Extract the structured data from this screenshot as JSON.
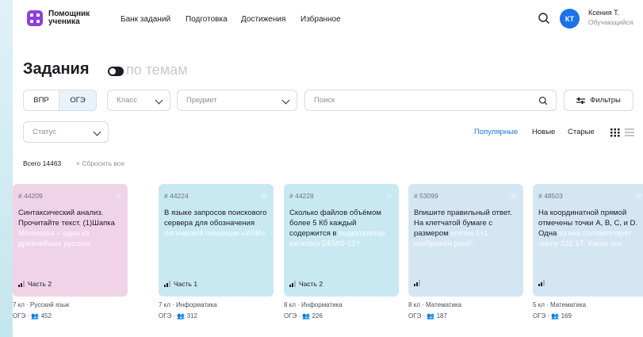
{
  "app": {
    "logo_line1": "Помощник",
    "logo_line2": "ученика",
    "accent": "#8b3fd9"
  },
  "nav": [
    "Банк заданий",
    "Подготовка",
    "Достижения",
    "Избранное"
  ],
  "user": {
    "initials": "КТ",
    "name": "Ксения Т.",
    "role": "Обучающийся"
  },
  "page": {
    "title": "Задания",
    "alt_view": "по темам"
  },
  "filters": {
    "exam_options": [
      "ВПР",
      "ОГЭ"
    ],
    "exam_selected": "ОГЭ",
    "class_placeholder": "Класс",
    "subject_placeholder": "Предмет",
    "search_placeholder": "Поиск",
    "filters_label": "Фильтры",
    "status_placeholder": "Статус"
  },
  "sort": {
    "options": [
      "Популярные",
      "Новые",
      "Старые"
    ],
    "selected": "Популярные"
  },
  "results": {
    "total": "Всего 14463",
    "reset": "× Сбросить все"
  },
  "cards": [
    {
      "id": "# 44209",
      "text": "Синтаксический анализ. Прочитайте текст. (1)Шапка",
      "faded": "Мономаха – одна из древнейших русских",
      "part": "Часть 2",
      "meta1": "7 кл · Русский язык",
      "meta2": "ОГЭ · 👥 452",
      "color": "#f1d3e8"
    },
    {
      "id": "# 44224",
      "text": "В языке запросов поискового сервера для обозначения",
      "faded": "логической операции «ИЛИ»",
      "part": "Часть 1",
      "meta1": "7 кл · Информатика",
      "meta2": "ОГЭ · 👥 312",
      "color": "#c9e9f2"
    },
    {
      "id": "# 44228",
      "text": "Сколько файлов объёмом более 5 Кб каждый содержится в",
      "faded": "подкаталогах каталога DEMO-12?",
      "part": "Часть 2",
      "meta1": "8 кл · Информатика",
      "meta2": "ОГЭ · 👥 226",
      "color": "#c9e9f2"
    },
    {
      "id": "# 53099",
      "text": "Впишите правильный ответ. На клетчатой бумаге с размером",
      "faded": "клетки 1×1 изображён ромб.",
      "part": "",
      "meta1": "8 кл · Математика",
      "meta2": "ОГЭ · 👥 187",
      "color": "#d5e6f3"
    },
    {
      "id": "# 48503",
      "text": "На координатной прямой отмечены точки A, B, C, и D. Одна",
      "faded": "из них соответствует числу 132 17. Какая это",
      "part": "",
      "meta1": "5 кл · Математика",
      "meta2": "ОГЭ · 👥 169",
      "color": "#d5e6f3"
    }
  ]
}
